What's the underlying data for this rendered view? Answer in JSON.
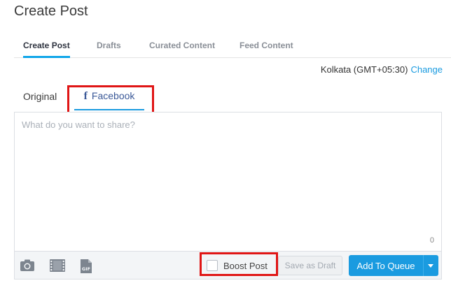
{
  "page": {
    "title": "Create Post"
  },
  "top_tabs": [
    {
      "label": "Create Post",
      "active": true
    },
    {
      "label": "Drafts",
      "active": false
    },
    {
      "label": "Curated Content",
      "active": false
    },
    {
      "label": "Feed Content",
      "active": false
    }
  ],
  "timezone": {
    "label": "Kolkata (GMT+05:30)",
    "change_label": "Change"
  },
  "network_tabs": [
    {
      "label": "Original",
      "active": false
    },
    {
      "label": "Facebook",
      "icon": "facebook-icon",
      "active": true
    }
  ],
  "editor": {
    "placeholder": "What do you want to share?",
    "value": "",
    "char_count": "0"
  },
  "toolbar": {
    "icons": [
      "camera-icon",
      "video-icon",
      "gif-icon"
    ],
    "boost_label": "Boost Post",
    "boost_checked": false,
    "save_draft_label": "Save as Draft",
    "add_queue_label": "Add To Queue"
  },
  "colors": {
    "accent": "#1a9be0",
    "highlight": "#e01515",
    "facebook": "#3b5998"
  }
}
